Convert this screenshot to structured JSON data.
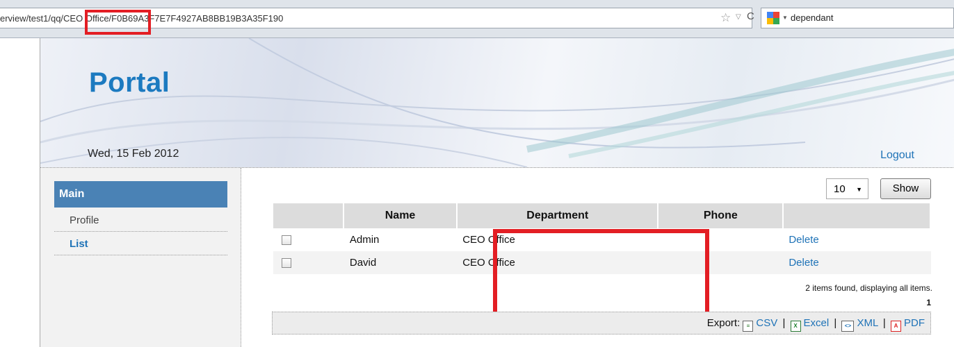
{
  "browser": {
    "url": "erview/test1/qq/CEO Office/F0B69A3F7E7F4927AB8BB19B3A35F190",
    "search_text": "dependant",
    "icons": [
      "star-icon",
      "dropdown-icon",
      "reload-icon",
      "search-engine-icon"
    ]
  },
  "header": {
    "logo": "Portal",
    "date": "Wed, 15 Feb 2012",
    "logout": "Logout"
  },
  "sidebar": {
    "heading": "Main",
    "items": [
      {
        "label": "Profile"
      },
      {
        "label": "List"
      }
    ]
  },
  "main": {
    "page_size": "10",
    "show_label": "Show",
    "columns": [
      "",
      "Name",
      "Department",
      "Phone",
      ""
    ],
    "rows": [
      {
        "name": "Admin",
        "department": "CEO Office",
        "phone": "",
        "action": "Delete"
      },
      {
        "name": "David",
        "department": "CEO Office",
        "phone": "",
        "action": "Delete"
      }
    ],
    "count_text": "2 items found, displaying all items.",
    "page_number": "1",
    "export": {
      "label": "Export:",
      "csv": "CSV",
      "excel": "Excel",
      "xml": "XML",
      "pdf": "PDF"
    }
  },
  "colors": {
    "highlight": "#e31e24",
    "link": "#1f73b7",
    "menu_head": "#4a82b5",
    "logo": "#1c7ac0"
  }
}
